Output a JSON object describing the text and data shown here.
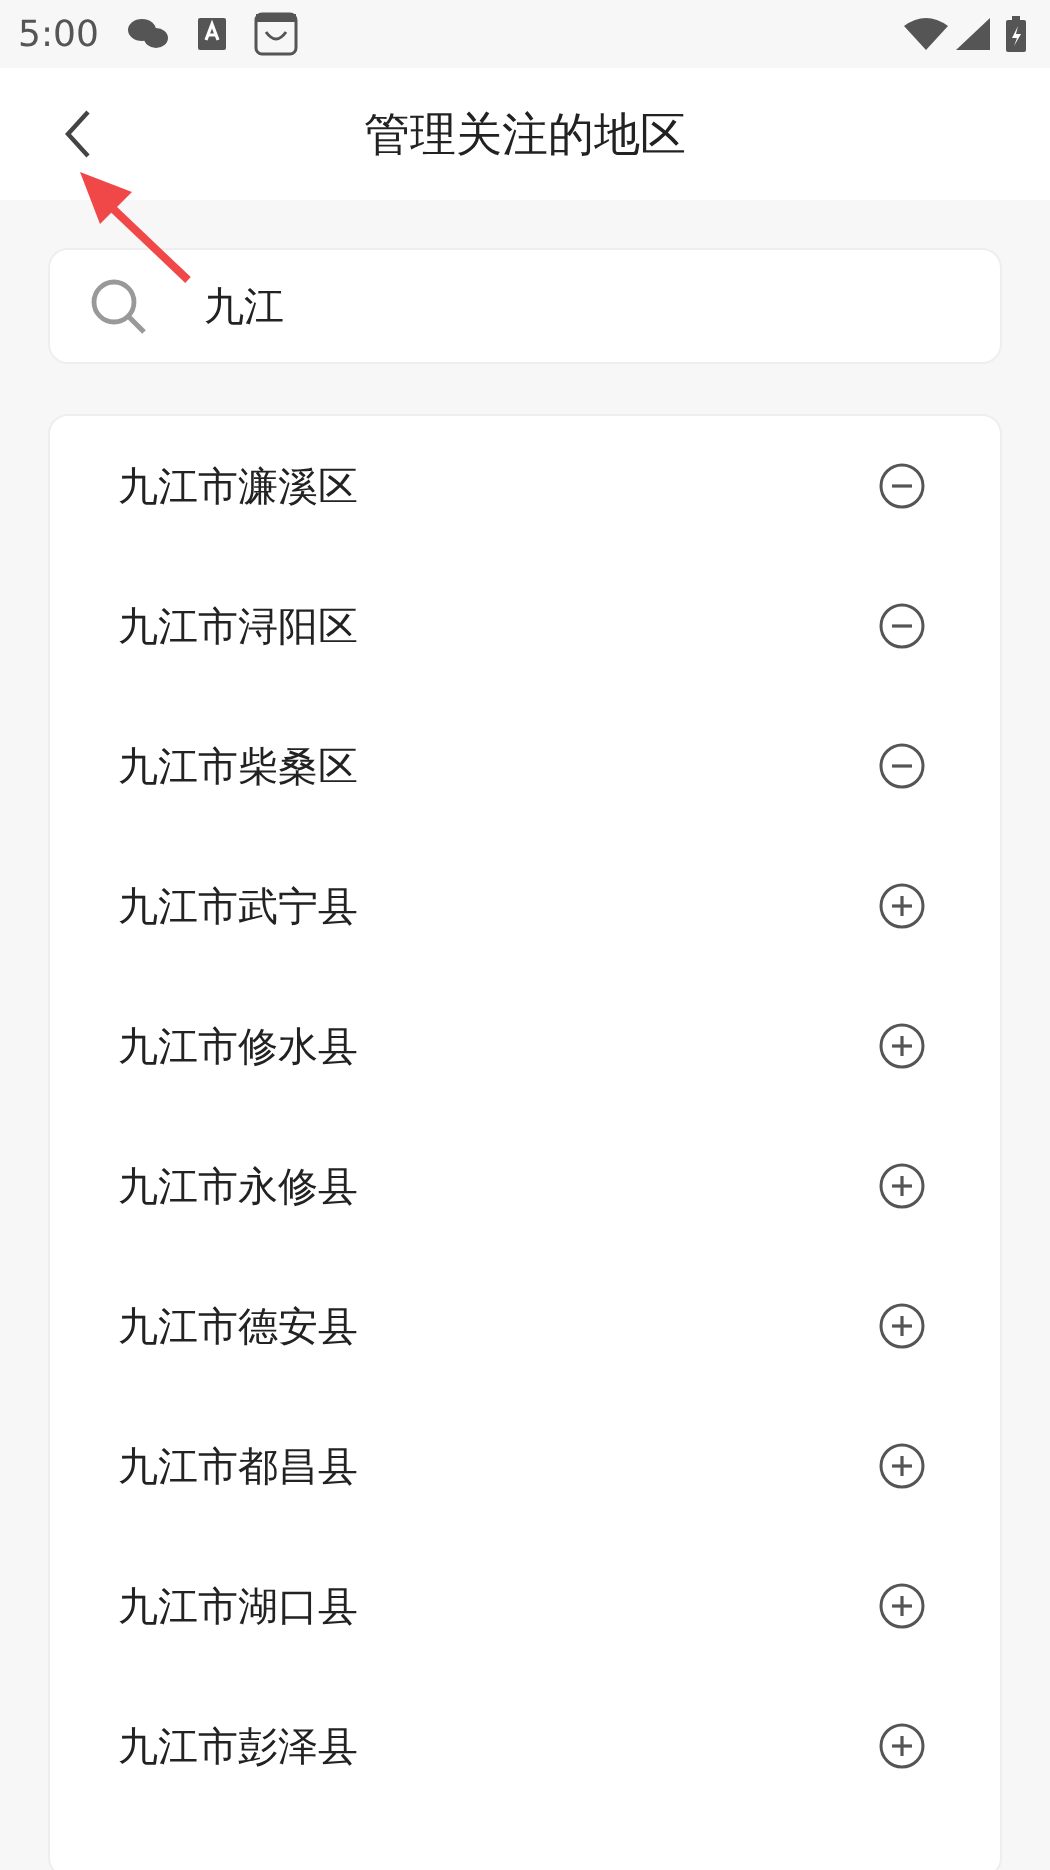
{
  "status_bar": {
    "time": "5:00"
  },
  "header": {
    "title": "管理关注的地区"
  },
  "search": {
    "value": "九江"
  },
  "regions": [
    {
      "name": "九江市濂溪区",
      "followed": true
    },
    {
      "name": "九江市浔阳区",
      "followed": true
    },
    {
      "name": "九江市柴桑区",
      "followed": true
    },
    {
      "name": "九江市武宁县",
      "followed": false
    },
    {
      "name": "九江市修水县",
      "followed": false
    },
    {
      "name": "九江市永修县",
      "followed": false
    },
    {
      "name": "九江市德安县",
      "followed": false
    },
    {
      "name": "九江市都昌县",
      "followed": false
    },
    {
      "name": "九江市湖口县",
      "followed": false
    },
    {
      "name": "九江市彭泽县",
      "followed": false
    }
  ]
}
